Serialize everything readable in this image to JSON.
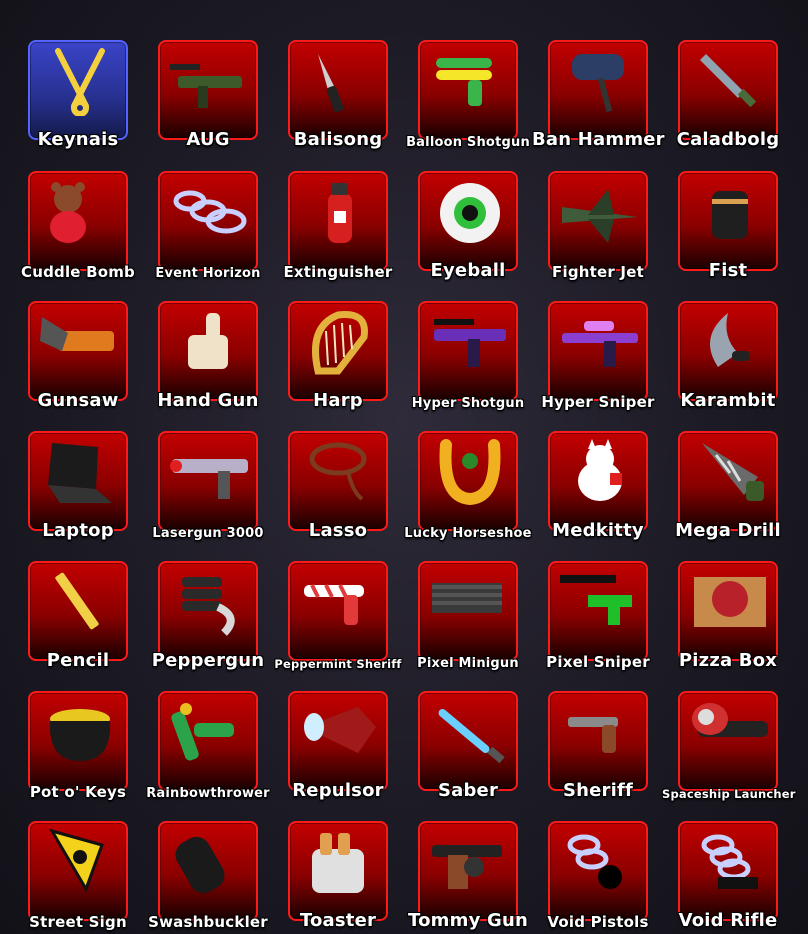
{
  "inventory": {
    "rows": [
      [
        {
          "label": "Keynais",
          "icon": "crossed-keys-icon",
          "color": "#f4d03f",
          "special": true
        },
        {
          "label": "AUG",
          "icon": "rifle-icon",
          "color": "#3c5a2a"
        },
        {
          "label": "Balisong",
          "icon": "knife-icon",
          "color": "#cfcfcf"
        },
        {
          "label": "Balloon Shotgun",
          "icon": "balloon-gun-icon",
          "color": "#39b54a"
        },
        {
          "label": "Ban Hammer",
          "icon": "hammer-icon",
          "color": "#2c3e66"
        },
        {
          "label": "Caladbolg",
          "icon": "sword-icon",
          "color": "#8fa3b0"
        }
      ],
      [
        {
          "label": "Cuddle Bomb",
          "icon": "teddy-bear-icon",
          "color": "#8b4a2b"
        },
        {
          "label": "Event Horizon",
          "icon": "spiral-gun-icon",
          "color": "#c8d0ff"
        },
        {
          "label": "Extinguisher",
          "icon": "extinguisher-icon",
          "color": "#d62020"
        },
        {
          "label": "Eyeball",
          "icon": "eyeball-icon",
          "color": "#2fbf3a"
        },
        {
          "label": "Fighter Jet",
          "icon": "jet-icon",
          "color": "#3f5b3a"
        },
        {
          "label": "Fist",
          "icon": "fist-icon",
          "color": "#1f1f1f"
        }
      ],
      [
        {
          "label": "Gunsaw",
          "icon": "chainsaw-icon",
          "color": "#e07a1f"
        },
        {
          "label": "Hand Gun",
          "icon": "thumbs-up-icon",
          "color": "#efe2c8"
        },
        {
          "label": "Harp",
          "icon": "harp-icon",
          "color": "#e3b23c"
        },
        {
          "label": "Hyper Shotgun",
          "icon": "purple-shotgun-icon",
          "color": "#6a2fb8"
        },
        {
          "label": "Hyper Sniper",
          "icon": "purple-sniper-icon",
          "color": "#8a3fd0"
        },
        {
          "label": "Karambit",
          "icon": "claw-knife-icon",
          "color": "#9aa4b0"
        }
      ],
      [
        {
          "label": "Laptop",
          "icon": "laptop-icon",
          "color": "#1b1b1b"
        },
        {
          "label": "Lasergun 3000",
          "icon": "laser-gun-icon",
          "color": "#b8b0c8"
        },
        {
          "label": "Lasso",
          "icon": "lasso-icon",
          "color": "#7a3b1f"
        },
        {
          "label": "Lucky Horseshoe",
          "icon": "horseshoe-icon",
          "color": "#f0b020"
        },
        {
          "label": "Medkitty",
          "icon": "cat-icon",
          "color": "#ffffff"
        },
        {
          "label": "Mega Drill",
          "icon": "drill-icon",
          "color": "#6a6a6a"
        }
      ],
      [
        {
          "label": "Pencil",
          "icon": "pencil-icon",
          "color": "#f1d048"
        },
        {
          "label": "Peppergun",
          "icon": "pepper-gun-icon",
          "color": "#2a2a2a"
        },
        {
          "label": "Peppermint Sheriff",
          "icon": "candy-gun-icon",
          "color": "#e23a3a"
        },
        {
          "label": "Pixel Minigun",
          "icon": "minigun-icon",
          "color": "#3a3a3a"
        },
        {
          "label": "Pixel Sniper",
          "icon": "pixel-sniper-icon",
          "color": "#1fbf2a"
        },
        {
          "label": "Pizza Box",
          "icon": "pizza-icon",
          "color": "#c88a4a"
        }
      ],
      [
        {
          "label": "Pot o' Keys",
          "icon": "pot-icon",
          "color": "#e8c820"
        },
        {
          "label": "Rainbowthrower",
          "icon": "flamethrower-icon",
          "color": "#2aa34a"
        },
        {
          "label": "Repulsor",
          "icon": "repulsor-icon",
          "color": "#a01a1a"
        },
        {
          "label": "Saber",
          "icon": "lightsaber-icon",
          "color": "#6ad0ff"
        },
        {
          "label": "Sheriff",
          "icon": "revolver-icon",
          "color": "#8a8a8a"
        },
        {
          "label": "Spaceship Launcher",
          "icon": "rocket-launcher-icon",
          "color": "#d03030"
        }
      ],
      [
        {
          "label": "Street Sign",
          "icon": "warning-sign-icon",
          "color": "#f2d21a"
        },
        {
          "label": "Swashbuckler",
          "icon": "cannon-icon",
          "color": "#1a1a1a"
        },
        {
          "label": "Toaster",
          "icon": "toaster-icon",
          "color": "#e0e0e0"
        },
        {
          "label": "Tommy Gun",
          "icon": "tommy-gun-icon",
          "color": "#8a4a2a"
        },
        {
          "label": "Void Pistols",
          "icon": "void-pistol-icon",
          "color": "#c8d0ff"
        },
        {
          "label": "Void Rifle",
          "icon": "void-rifle-icon",
          "color": "#c8d0ff"
        }
      ]
    ]
  }
}
